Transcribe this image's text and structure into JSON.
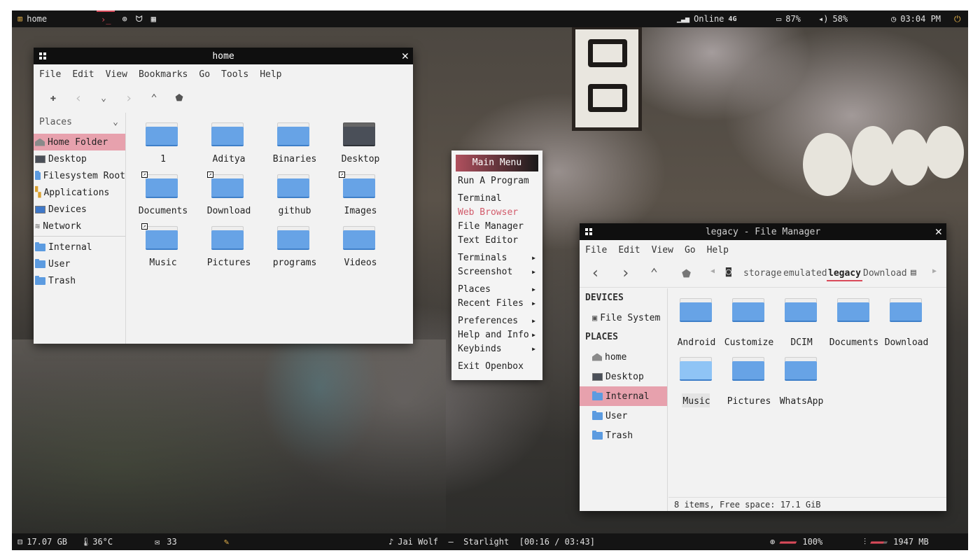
{
  "topbar": {
    "workspace": "home",
    "terminal_glyph": "›_",
    "network": "Online",
    "network_type": "4G",
    "battery": "87%",
    "volume": "58%",
    "clock": "03:04 PM"
  },
  "bottombar": {
    "disk": "17.07 GB",
    "temp": "36°C",
    "mail_count": "33",
    "now_playing": "Jai Wolf  –  Starlight  [00:16 / 03:43]",
    "cpu": "100%",
    "memory": "1947 MB"
  },
  "home_window": {
    "title": "home",
    "menu": [
      "File",
      "Edit",
      "View",
      "Bookmarks",
      "Go",
      "Tools",
      "Help"
    ],
    "places_label": "Places",
    "places": [
      "Home Folder",
      "Desktop",
      "Filesystem Root",
      "Applications",
      "Devices",
      "Network"
    ],
    "bookmarks": [
      "Internal",
      "User",
      "Trash"
    ],
    "files": [
      "1",
      "Aditya",
      "Binaries",
      "Desktop",
      "Documents",
      "Download",
      "github",
      "Images",
      "Music",
      "Pictures",
      "programs",
      "Videos"
    ]
  },
  "main_menu": {
    "title": "Main Menu",
    "items": [
      "Run A Program",
      "Terminal",
      "Web Browser",
      "File Manager",
      "Text Editor",
      "Terminals",
      "Screenshot",
      "Places",
      "Recent Files",
      "Preferences",
      "Help and Info",
      "Keybinds",
      "Exit Openbox"
    ]
  },
  "fm_window": {
    "title": "legacy - File Manager",
    "menu": [
      "File",
      "Edit",
      "View",
      "Go",
      "Help"
    ],
    "path": [
      "storage",
      "emulated",
      "legacy",
      "Download"
    ],
    "devices_label": "DEVICES",
    "devices": [
      "File System"
    ],
    "places_label": "PLACES",
    "places": [
      "home",
      "Desktop",
      "Internal",
      "User",
      "Trash"
    ],
    "files": [
      "Android",
      "Customize",
      "DCIM",
      "Documents",
      "Download",
      "Music",
      "Pictures",
      "WhatsApp"
    ],
    "status": "8 items, Free space: 17.1 GiB"
  }
}
